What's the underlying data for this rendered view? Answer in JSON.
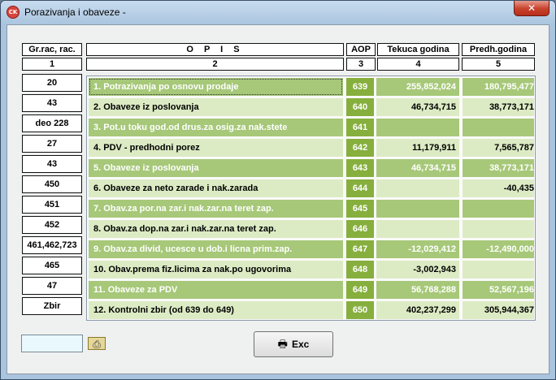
{
  "window": {
    "title": "Porazivanja i obaveze  -",
    "app_icon_text": "CK",
    "close_glyph": "✕"
  },
  "headers": {
    "col1": "Gr.rac, rac.",
    "col2": "O P I S",
    "col3": "AOP",
    "col4": "Tekuca godina",
    "col5": "Predh.godina"
  },
  "header_numbers": [
    "1",
    "2",
    "3",
    "4",
    "5"
  ],
  "accounts": [
    "20",
    "43",
    "deo 228",
    "27",
    "43",
    "450",
    "451",
    "452",
    "461,462,723",
    "465",
    "47",
    "Zbir"
  ],
  "rows": [
    {
      "opis": "1. Potrazivanja po osnovu prodaje",
      "aop": "639",
      "tekuca": "255,852,024",
      "prethodna": "180,795,477"
    },
    {
      "opis": "2. Obaveze iz poslovanja",
      "aop": "640",
      "tekuca": "46,734,715",
      "prethodna": "38,773,171"
    },
    {
      "opis": "3. Pot.u toku god.od drus.za osig.za nak.stete",
      "aop": "641",
      "tekuca": "",
      "prethodna": ""
    },
    {
      "opis": "4. PDV - predhodni porez",
      "aop": "642",
      "tekuca": "11,179,911",
      "prethodna": "7,565,787"
    },
    {
      "opis": "5. Obaveze iz poslovanja",
      "aop": "643",
      "tekuca": "46,734,715",
      "prethodna": "38,773,171"
    },
    {
      "opis": "6. Obaveze za neto zarade i nak.zarada",
      "aop": "644",
      "tekuca": "",
      "prethodna": "-40,435"
    },
    {
      "opis": "7. Obav.za por.na zar.i nak.zar.na teret zap.",
      "aop": "645",
      "tekuca": "",
      "prethodna": ""
    },
    {
      "opis": "8. Obav.za dop.na zar.i nak.zar.na teret zap.",
      "aop": "646",
      "tekuca": "",
      "prethodna": ""
    },
    {
      "opis": "9. Obav.za divid, ucesce u dob.i licna prim.zap.",
      "aop": "647",
      "tekuca": "-12,029,412",
      "prethodna": "-12,490,000"
    },
    {
      "opis": "10. Obav.prema fiz.licima za nak.po ugovorima",
      "aop": "648",
      "tekuca": "-3,002,943",
      "prethodna": ""
    },
    {
      "opis": "11. Obaveze za PDV",
      "aop": "649",
      "tekuca": "56,768,288",
      "prethodna": "52,567,196"
    },
    {
      "opis": "12. Kontrolni zbir (od 639 do 649)",
      "aop": "650",
      "tekuca": "402,237,299",
      "prethodna": "305,944,367"
    }
  ],
  "footer": {
    "input_value": "",
    "exc_label": "Exc",
    "printer_glyph": "🖶",
    "small_icon_glyph": "⎙"
  },
  "colors": {
    "aop_cell": "#86af3d",
    "row_dark": "#a6c878",
    "row_light": "#dcebc4"
  }
}
